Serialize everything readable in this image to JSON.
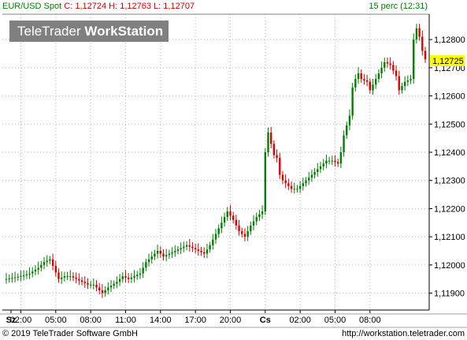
{
  "header": {
    "symbol": "EUR/USD Spot",
    "close_label": "C:",
    "close_value": "1,12724",
    "high_label": "H:",
    "high_value": "1,12763",
    "low_label": "L:",
    "low_value": "1,12707",
    "interval": "15 perc (12:31)"
  },
  "logo": {
    "part1": "TeleTrader",
    "part2": "WorkStation"
  },
  "footer": {
    "copyright": "© 2019 TeleTrader Software GmbH",
    "url": "http://workstation.teletrader.com"
  },
  "colors": {
    "up": "#008000",
    "down": "#dd0000",
    "grid": "#b4b4b4",
    "marker": "#ffff00",
    "axis": "#000000"
  },
  "chart_data": {
    "type": "candlestick",
    "ylim": [
      1.1184,
      1.1289
    ],
    "y_ticks": [
      {
        "value": 1.128,
        "label": "1,12800"
      },
      {
        "value": 1.127,
        "label": "1,12700"
      },
      {
        "value": 1.126,
        "label": "1,12600"
      },
      {
        "value": 1.125,
        "label": "1,12500"
      },
      {
        "value": 1.124,
        "label": "1,12400"
      },
      {
        "value": 1.123,
        "label": "1,12300"
      },
      {
        "value": 1.122,
        "label": "1,12200"
      },
      {
        "value": 1.121,
        "label": "1,12100"
      },
      {
        "value": 1.12,
        "label": "1,12000"
      },
      {
        "value": 1.119,
        "label": "1,11900"
      }
    ],
    "x_ticks": [
      {
        "label": "Sz",
        "bold": true
      },
      {
        "label": "02:00",
        "bold": false
      },
      {
        "label": "05:00",
        "bold": false
      },
      {
        "label": "08:00",
        "bold": false
      },
      {
        "label": "11:00",
        "bold": false
      },
      {
        "label": "14:00",
        "bold": false
      },
      {
        "label": "17:00",
        "bold": false
      },
      {
        "label": "20:00",
        "bold": false
      },
      {
        "label": "Cs",
        "bold": true
      },
      {
        "label": "02:00",
        "bold": false
      },
      {
        "label": "05:00",
        "bold": false
      },
      {
        "label": "08:00",
        "bold": false
      }
    ],
    "last_value_label": "1,12725",
    "last_value": 1.12725,
    "anchors": [
      [
        0,
        1.1195
      ],
      [
        5,
        1.1196
      ],
      [
        8,
        1.1197
      ],
      [
        11,
        1.1199
      ],
      [
        13,
        1.1201
      ],
      [
        15,
        1.1202
      ],
      [
        18,
        1.1195
      ],
      [
        20,
        1.1196
      ],
      [
        22,
        1.1196
      ],
      [
        24,
        1.1195
      ],
      [
        26,
        1.1194
      ],
      [
        28,
        1.1193
      ],
      [
        30,
        1.1193
      ],
      [
        32,
        1.1191
      ],
      [
        33,
        1.119
      ],
      [
        35,
        1.1192
      ],
      [
        38,
        1.1194
      ],
      [
        40,
        1.1196
      ],
      [
        42,
        1.1195
      ],
      [
        44,
        1.1196
      ],
      [
        46,
        1.1197
      ],
      [
        48,
        1.1201
      ],
      [
        50,
        1.1203
      ],
      [
        52,
        1.1205
      ],
      [
        54,
        1.1203
      ],
      [
        56,
        1.1204
      ],
      [
        58,
        1.1205
      ],
      [
        60,
        1.1206
      ],
      [
        62,
        1.1207
      ],
      [
        64,
        1.1206
      ],
      [
        66,
        1.1205
      ],
      [
        68,
        1.1204
      ],
      [
        70,
        1.1207
      ],
      [
        72,
        1.1211
      ],
      [
        74,
        1.1215
      ],
      [
        76,
        1.1219
      ],
      [
        78,
        1.1216
      ],
      [
        80,
        1.1212
      ],
      [
        82,
        1.121
      ],
      [
        84,
        1.1214
      ],
      [
        86,
        1.1217
      ],
      [
        88,
        1.1219
      ],
      [
        89,
        1.124
      ],
      [
        90,
        1.1247
      ],
      [
        91,
        1.1243
      ],
      [
        92,
        1.1239
      ],
      [
        93,
        1.1238
      ],
      [
        94,
        1.1232
      ],
      [
        95,
        1.123
      ],
      [
        96,
        1.1229
      ],
      [
        98,
        1.1227
      ],
      [
        100,
        1.1227
      ],
      [
        102,
        1.1229
      ],
      [
        104,
        1.1231
      ],
      [
        106,
        1.1233
      ],
      [
        108,
        1.1235
      ],
      [
        110,
        1.1237
      ],
      [
        112,
        1.1237
      ],
      [
        114,
        1.1236
      ],
      [
        115,
        1.124
      ],
      [
        116,
        1.1246
      ],
      [
        118,
        1.1253
      ],
      [
        119,
        1.1263
      ],
      [
        120,
        1.1266
      ],
      [
        121,
        1.1268
      ],
      [
        122,
        1.1266
      ],
      [
        124,
        1.1265
      ],
      [
        125,
        1.1262
      ],
      [
        126,
        1.1264
      ],
      [
        128,
        1.1268
      ],
      [
        130,
        1.1272
      ],
      [
        132,
        1.1271
      ],
      [
        133,
        1.1269
      ],
      [
        134,
        1.1267
      ],
      [
        135,
        1.1262
      ],
      [
        137,
        1.1265
      ],
      [
        139,
        1.1266
      ],
      [
        140,
        1.128
      ],
      [
        141,
        1.1284
      ],
      [
        142,
        1.1281
      ],
      [
        143,
        1.1276
      ],
      [
        144,
        1.1273
      ]
    ]
  }
}
